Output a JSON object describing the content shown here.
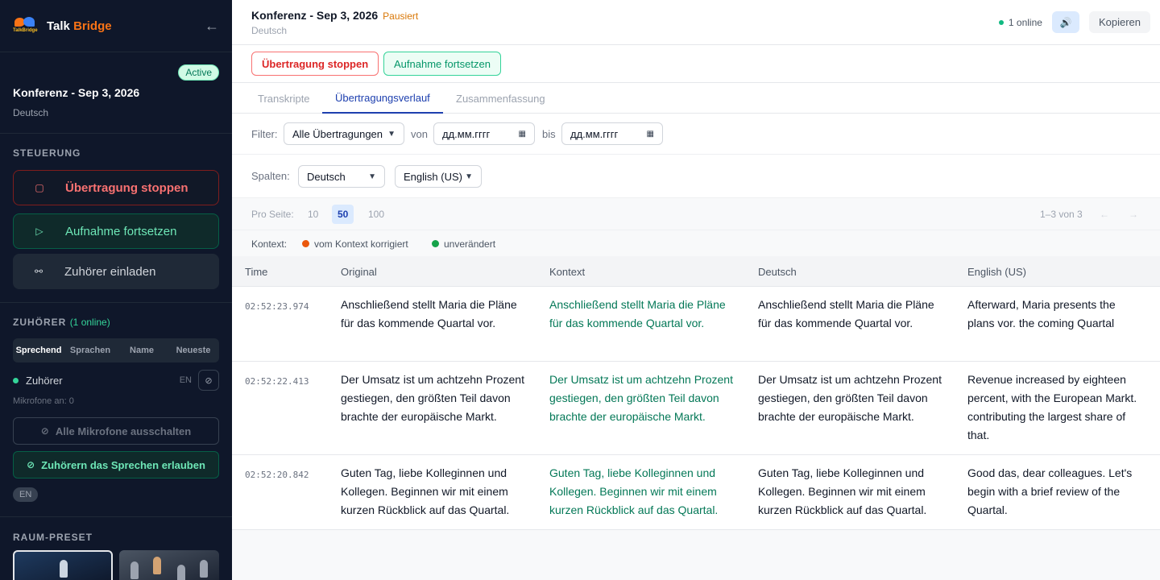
{
  "brand": {
    "logo_text": "TalkBridge",
    "name_a": "Talk",
    "name_b": "Bridge"
  },
  "session": {
    "badge": "Active",
    "title": "Konferenz - Sep 3, 2026",
    "language": "Deutsch"
  },
  "control": {
    "label": "STEUERUNG",
    "stop": "Übertragung stoppen",
    "resume": "Aufnahme fortsetzen",
    "invite": "Zuhörer einladen"
  },
  "listeners": {
    "label": "ZUHÖRER",
    "online": "(1 online)",
    "tabs": [
      "Sprechend",
      "Sprachen",
      "Name",
      "Neueste"
    ],
    "item": {
      "name": "Zuhörer",
      "lang": "EN"
    },
    "mics_on": "Mikrofone an: 0",
    "mute_all": "Alle Mikrofone ausschalten",
    "allow_speak": "Zuhörern das Sprechen erlauben",
    "lang_pill": "EN"
  },
  "preset": {
    "label": "RAUM-PRESET"
  },
  "topbar": {
    "title": "Konferenz - Sep 3, 2026",
    "status": "Pausiert",
    "language": "Deutsch",
    "online": "1 online",
    "copy": "Kopieren"
  },
  "actions": {
    "stop": "Übertragung stoppen",
    "resume": "Aufnahme fortsetzen"
  },
  "tabs": [
    "Transkripte",
    "Übertragungsverlauf",
    "Zusammenfassung"
  ],
  "filter": {
    "label": "Filter:",
    "select": "Alle Übertragungen",
    "from_label": "von",
    "from_placeholder": "дд.мм.гггг",
    "to_label": "bis",
    "to_placeholder": "дд.мм.гггг"
  },
  "columns": {
    "label": "Spalten:",
    "col1": "Deutsch",
    "col2": "English (US)"
  },
  "pager": {
    "label": "Pro Seite:",
    "options": [
      "10",
      "50",
      "100"
    ],
    "range": "1–3 von 3",
    "prev": "←",
    "next": "→"
  },
  "context": {
    "label": "Kontext:",
    "corrected": "vom Kontext korrigiert",
    "unchanged": "unverändert",
    "corrected_color": "#ea580c",
    "unchanged_color": "#16a34a"
  },
  "table": {
    "headers": [
      "Time",
      "Original",
      "Kontext",
      "Deutsch",
      "English (US)"
    ],
    "rows": [
      {
        "time": "02:52:23.974",
        "original": "Anschließend stellt Maria die Pläne für das kommende Quartal vor.",
        "kontext": "Anschließend stellt Maria die Pläne für das kommende Quartal vor.",
        "deutsch": "Anschließend stellt Maria die Pläne für das kommende Quartal vor.",
        "english": "Afterward, Maria presents the plans vor. the coming Quartal"
      },
      {
        "time": "02:52:22.413",
        "original": "Der Umsatz ist um achtzehn Prozent gestiegen, den größten Teil davon brachte der europäische Markt.",
        "kontext": "Der Umsatz ist um achtzehn Prozent gestiegen, den größten Teil davon brachte der europäische Markt.",
        "deutsch": "Der Umsatz ist um achtzehn Prozent gestiegen, den größten Teil davon brachte der europäische Markt.",
        "english": "Revenue increased by eighteen percent, with the European Markt. contributing the largest share of that."
      },
      {
        "time": "02:52:20.842",
        "original": "Guten Tag, liebe Kolleginnen und Kollegen. Beginnen wir mit einem kurzen Rückblick auf das Quartal.",
        "kontext": "Guten Tag, liebe Kolleginnen und Kollegen. Beginnen wir mit einem kurzen Rückblick auf das Quartal.",
        "deutsch": "Guten Tag, liebe Kolleginnen und Kollegen. Beginnen wir mit einem kurzen Rückblick auf das Quartal.",
        "english": "Good das, dear colleagues. Let's begin with a brief review of the Quartal."
      }
    ]
  }
}
